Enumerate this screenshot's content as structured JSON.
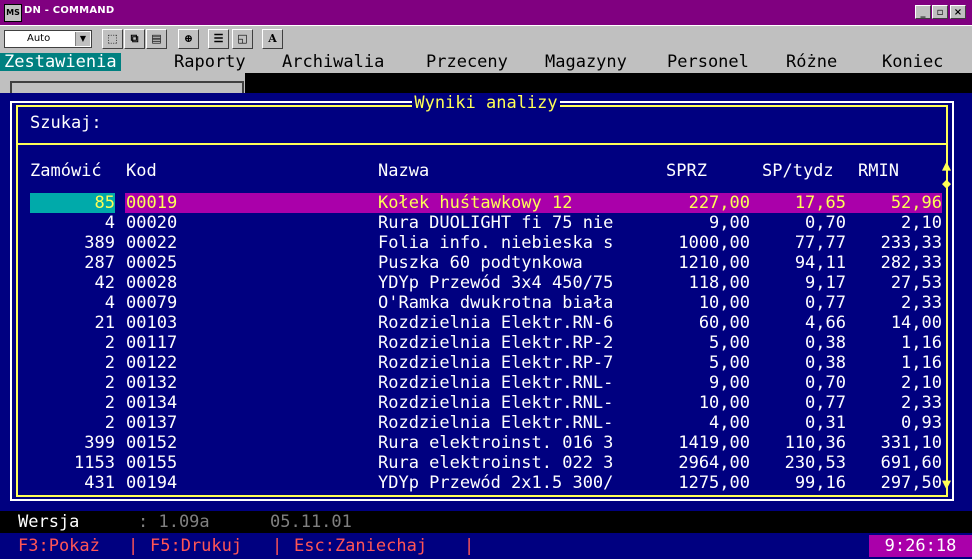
{
  "window": {
    "title": "DN - COMMAND",
    "icon_text": "MS"
  },
  "toolbar": {
    "font_select": "Auto"
  },
  "menu": [
    "Zestawienia",
    "Raporty",
    "Archiwalia",
    "Przeceny",
    "Magazyny",
    "Personel",
    "Różne",
    "Koniec"
  ],
  "panel": {
    "title": "Wyniki analizy",
    "search_label": "Szukaj:",
    "headers": {
      "zamowic": "Zamówić",
      "kod": "Kod",
      "nazwa": "Nazwa",
      "sprz": "SPRZ",
      "sptydz": "SP/tydz",
      "rmin": "RMIN"
    },
    "rows": [
      {
        "zamowic": "85",
        "kod": "00019",
        "nazwa": "Kołek huśtawkowy 12",
        "sprz": "227,00",
        "sptydz": "17,65",
        "rmin": "52,96"
      },
      {
        "zamowic": "4",
        "kod": "00020",
        "nazwa": "Rura DUOLIGHT fi 75 nie",
        "sprz": "9,00",
        "sptydz": "0,70",
        "rmin": "2,10"
      },
      {
        "zamowic": "389",
        "kod": "00022",
        "nazwa": "Folia info. niebieska s",
        "sprz": "1000,00",
        "sptydz": "77,77",
        "rmin": "233,33"
      },
      {
        "zamowic": "287",
        "kod": "00025",
        "nazwa": "Puszka 60 podtynkowa",
        "sprz": "1210,00",
        "sptydz": "94,11",
        "rmin": "282,33"
      },
      {
        "zamowic": "42",
        "kod": "00028",
        "nazwa": "YDYp Przewód 3x4 450/75",
        "sprz": "118,00",
        "sptydz": "9,17",
        "rmin": "27,53"
      },
      {
        "zamowic": "4",
        "kod": "00079",
        "nazwa": "O'Ramka dwukrotna biała",
        "sprz": "10,00",
        "sptydz": "0,77",
        "rmin": "2,33"
      },
      {
        "zamowic": "21",
        "kod": "00103",
        "nazwa": "Rozdzielnia Elektr.RN-6",
        "sprz": "60,00",
        "sptydz": "4,66",
        "rmin": "14,00"
      },
      {
        "zamowic": "2",
        "kod": "00117",
        "nazwa": "Rozdzielnia Elektr.RP-2",
        "sprz": "5,00",
        "sptydz": "0,38",
        "rmin": "1,16"
      },
      {
        "zamowic": "2",
        "kod": "00122",
        "nazwa": "Rozdzielnia Elektr.RP-7",
        "sprz": "5,00",
        "sptydz": "0,38",
        "rmin": "1,16"
      },
      {
        "zamowic": "2",
        "kod": "00132",
        "nazwa": "Rozdzielnia Elektr.RNL-",
        "sprz": "9,00",
        "sptydz": "0,70",
        "rmin": "2,10"
      },
      {
        "zamowic": "2",
        "kod": "00134",
        "nazwa": "Rozdzielnia Elektr.RNL-",
        "sprz": "10,00",
        "sptydz": "0,77",
        "rmin": "2,33"
      },
      {
        "zamowic": "2",
        "kod": "00137",
        "nazwa": "Rozdzielnia Elektr.RNL-",
        "sprz": "4,00",
        "sptydz": "0,31",
        "rmin": "0,93"
      },
      {
        "zamowic": "399",
        "kod": "00152",
        "nazwa": "Rura elektroinst. 016 3",
        "sprz": "1419,00",
        "sptydz": "110,36",
        "rmin": "331,10"
      },
      {
        "zamowic": "1153",
        "kod": "00155",
        "nazwa": "Rura elektroinst. 022 3",
        "sprz": "2964,00",
        "sptydz": "230,53",
        "rmin": "691,60"
      },
      {
        "zamowic": "431",
        "kod": "00194",
        "nazwa": "YDYp Przewód 2x1.5 300/",
        "sprz": "1275,00",
        "sptydz": "99,16",
        "rmin": "297,50"
      }
    ]
  },
  "status": {
    "version_label": "Wersja",
    "version": ": 1.09a",
    "date": "05.11.01"
  },
  "fkeys": [
    "F3:Pokaż",
    "F5:Drukuj",
    "Esc:Zaniechaj"
  ],
  "fkey_separator": "|",
  "clock": "9:26:18",
  "colors": {
    "title_bar": "#800080",
    "panel_bg": "#000080",
    "highlight": "#aa00aa",
    "accent": "#ffff55",
    "active_menu": "#008080"
  }
}
